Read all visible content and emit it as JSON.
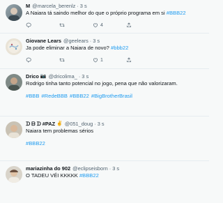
{
  "tweets": [
    {
      "name": "M",
      "handle": "@marcela_berenlz",
      "separator": "·",
      "time": "3 s",
      "text_before": "A Naiara tá saindo melhor do que o próprio programa em si ",
      "hashtag": "#BBB22",
      "actions": {
        "reply": "",
        "retweet": "",
        "like": "4",
        "share": ""
      }
    },
    {
      "name": "Giovane Lears",
      "handle": "@geelears",
      "separator": "·",
      "time": "3 s",
      "text_before": "Ja pode eliminar a Naiara de novo? ",
      "hashtag": "#bbb22",
      "actions": {
        "reply": "",
        "retweet": "",
        "like": "1",
        "share": ""
      }
    },
    {
      "name": "Drico",
      "handle": "@dricolima_",
      "separator": "·",
      "time": "3 s",
      "text": "Rodrigo tinha tanto potencial no jogo, pena que não valorizaram.",
      "tags": [
        "#BBB",
        "#RedeBBB",
        "#BBB22",
        "#BigBrotherBrasil"
      ],
      "actions": {
        "reply": "",
        "retweet": "",
        "like": "",
        "share": ""
      }
    },
    {
      "name": "ᗪ ᗷ ᗪ #PAZ",
      "handle": "@051_doug",
      "separator": "·",
      "time": "3 s",
      "text": "Naiara tem problemas sérios",
      "tags": [
        "#BBB22"
      ],
      "actions": {
        "reply": "",
        "retweet": "",
        "like": "",
        "share": ""
      }
    },
    {
      "name": "mariazinha do 902",
      "handle": "@eclipseisborn",
      "separator": "·",
      "time": "3 s",
      "text_before": "O TADEU VÉI KKKKK ",
      "hashtag": "#BBB22",
      "actions": {
        "reply": "",
        "retweet": "",
        "like": "",
        "share": ""
      }
    }
  ],
  "icons": [
    "reply-icon",
    "retweet-icon",
    "like-icon",
    "share-icon"
  ],
  "colors": {
    "accent": "#1d9bf0",
    "muted": "#536471",
    "background": "#f7f9f9"
  }
}
